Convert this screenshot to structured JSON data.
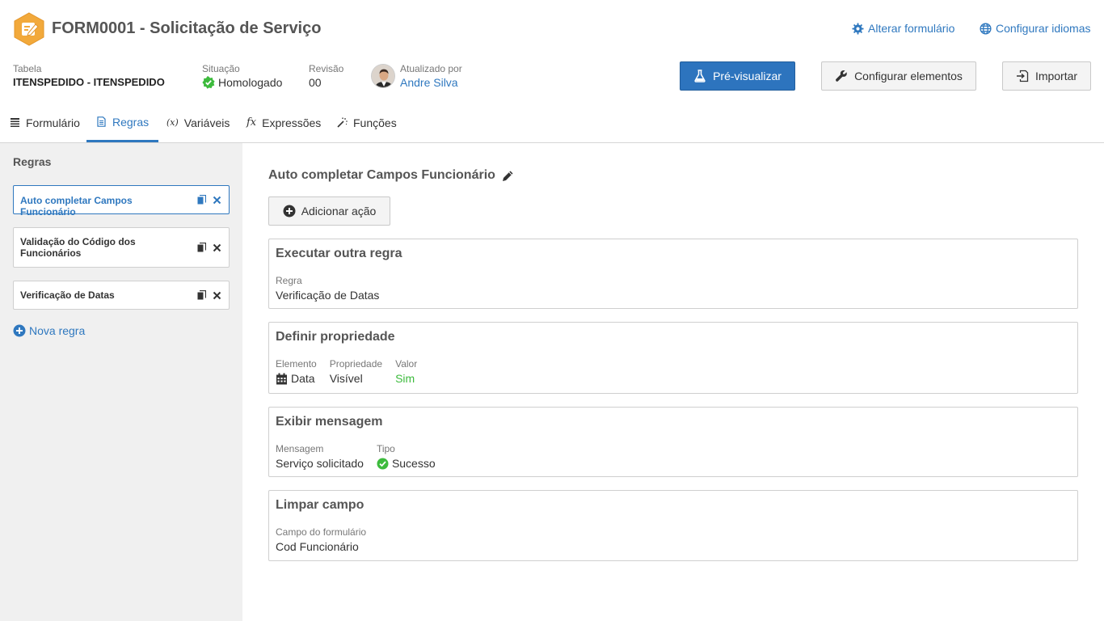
{
  "header": {
    "title": "FORM0001 - Solicitação de Serviço",
    "links": {
      "alterar": "Alterar formulário",
      "idiomas": "Configurar idiomas"
    },
    "meta": {
      "tabela_label": "Tabela",
      "tabela_value": "ITENSPEDIDO - ITENSPEDIDO",
      "situacao_label": "Situação",
      "situacao_value": "Homologado",
      "revisao_label": "Revisão",
      "revisao_value": "00",
      "atualizado_label": "Atualizado por",
      "atualizado_value": "Andre Silva"
    },
    "buttons": {
      "preview": "Pré-visualizar",
      "configurar": "Configurar elementos",
      "importar": "Importar"
    }
  },
  "tabs": [
    {
      "label": "Formulário"
    },
    {
      "label": "Regras"
    },
    {
      "label": "Variáveis",
      "glyph": "(x)"
    },
    {
      "label": "Expressões",
      "glyph": "fx"
    },
    {
      "label": "Funções"
    }
  ],
  "sidebar": {
    "title": "Regras",
    "rules": [
      {
        "name": "Auto completar Campos Funcionário"
      },
      {
        "name": "Validação do Código dos Funcionários"
      },
      {
        "name": "Verificação de Datas"
      }
    ],
    "new_rule": "Nova regra"
  },
  "main": {
    "title": "Auto completar Campos Funcionário",
    "add_action": "Adicionar ação",
    "actions": [
      {
        "title": "Executar outra regra",
        "fields": [
          {
            "label": "Regra",
            "value": "Verificação de Datas"
          }
        ]
      },
      {
        "title": "Definir propriedade",
        "fields": [
          {
            "label": "Elemento",
            "value": "Data",
            "icon": "calendar-icon"
          },
          {
            "label": "Propriedade",
            "value": "Visível"
          },
          {
            "label": "Valor",
            "value": "Sim"
          }
        ]
      },
      {
        "title": "Exibir mensagem",
        "fields": [
          {
            "label": "Mensagem",
            "value": "Serviço solicitado"
          },
          {
            "label": "Tipo",
            "value": "Sucesso",
            "icon": "check-circle-icon"
          }
        ]
      },
      {
        "title": "Limpar campo",
        "fields": [
          {
            "label": "Campo do formulário",
            "value": "Cod Funcionário"
          }
        ]
      }
    ]
  },
  "colors": {
    "accent": "#2f78bf",
    "primary_button": "#2d74be",
    "success": "#3dbb3d",
    "logo": "#f2a93b",
    "sidebar_bg": "#f0f0f0"
  }
}
